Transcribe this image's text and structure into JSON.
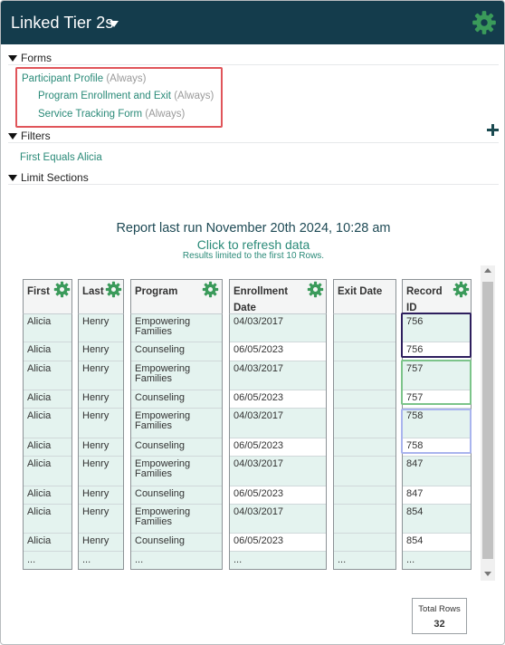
{
  "header": {
    "title": "Linked Tier 2s",
    "settings_icon": "gear-icon",
    "dropdown_icon": "caret-down-icon"
  },
  "sections": {
    "forms": {
      "label": "Forms",
      "items": [
        {
          "name": "Participant Profile",
          "qualifier": "(Always)"
        },
        {
          "name": "Program Enrollment and Exit",
          "qualifier": "(Always)"
        },
        {
          "name": "Service Tracking Form",
          "qualifier": "(Always)"
        }
      ]
    },
    "filters": {
      "label": "Filters",
      "items": [
        "First Equals Alicia"
      ],
      "add_icon": "plus-icon"
    },
    "limit_sections": {
      "label": "Limit Sections"
    }
  },
  "report": {
    "last_run": "Report last run November 20th 2024, 10:28 am",
    "refresh_link": "Click to refresh data",
    "limit_note": "Results limited to the first 10 Rows."
  },
  "table": {
    "columns": [
      {
        "label": "First",
        "key": "first"
      },
      {
        "label": "Last",
        "key": "last"
      },
      {
        "label": "Program",
        "key": "program"
      },
      {
        "label": "Enrollment Date",
        "key": "enrollment"
      },
      {
        "label": "Exit Date",
        "key": "exit"
      },
      {
        "label": "Record ID",
        "key": "record"
      }
    ],
    "rows": [
      {
        "first": "Alicia",
        "last": "Henry",
        "program": "Empowering Families",
        "enrollment": "04/03/2017",
        "exit": "",
        "record": "756"
      },
      {
        "first": "Alicia",
        "last": "Henry",
        "program": "Counseling",
        "enrollment": "06/05/2023",
        "exit": "",
        "record": "756"
      },
      {
        "first": "Alicia",
        "last": "Henry",
        "program": "Empowering Families",
        "enrollment": "04/03/2017",
        "exit": "",
        "record": "757"
      },
      {
        "first": "Alicia",
        "last": "Henry",
        "program": "Counseling",
        "enrollment": "06/05/2023",
        "exit": "",
        "record": "757"
      },
      {
        "first": "Alicia",
        "last": "Henry",
        "program": "Empowering Families",
        "enrollment": "04/03/2017",
        "exit": "",
        "record": "758"
      },
      {
        "first": "Alicia",
        "last": "Henry",
        "program": "Counseling",
        "enrollment": "06/05/2023",
        "exit": "",
        "record": "758"
      },
      {
        "first": "Alicia",
        "last": "Henry",
        "program": "Empowering Families",
        "enrollment": "04/03/2017",
        "exit": "",
        "record": "847"
      },
      {
        "first": "Alicia",
        "last": "Henry",
        "program": "Counseling",
        "enrollment": "06/05/2023",
        "exit": "",
        "record": "847"
      },
      {
        "first": "Alicia",
        "last": "Henry",
        "program": "Empowering Families",
        "enrollment": "04/03/2017",
        "exit": "",
        "record": "854"
      },
      {
        "first": "Alicia",
        "last": "Henry",
        "program": "Counseling",
        "enrollment": "06/05/2023",
        "exit": "",
        "record": "854"
      }
    ],
    "ellipsis": "...",
    "column_settings_icon": "gear-icon"
  },
  "total_rows": {
    "label": "Total Rows",
    "value": "32"
  },
  "colors": {
    "header_bg": "#143c4c",
    "accent_teal": "#2a8a78",
    "gear_green": "#3a9a5a",
    "highlight_red": "#e0555a",
    "highlight_purple": "#2e1f5e",
    "highlight_green": "#7cc48a",
    "highlight_blue": "#a9b4ee",
    "cell_bg": "#e4f3ef"
  }
}
